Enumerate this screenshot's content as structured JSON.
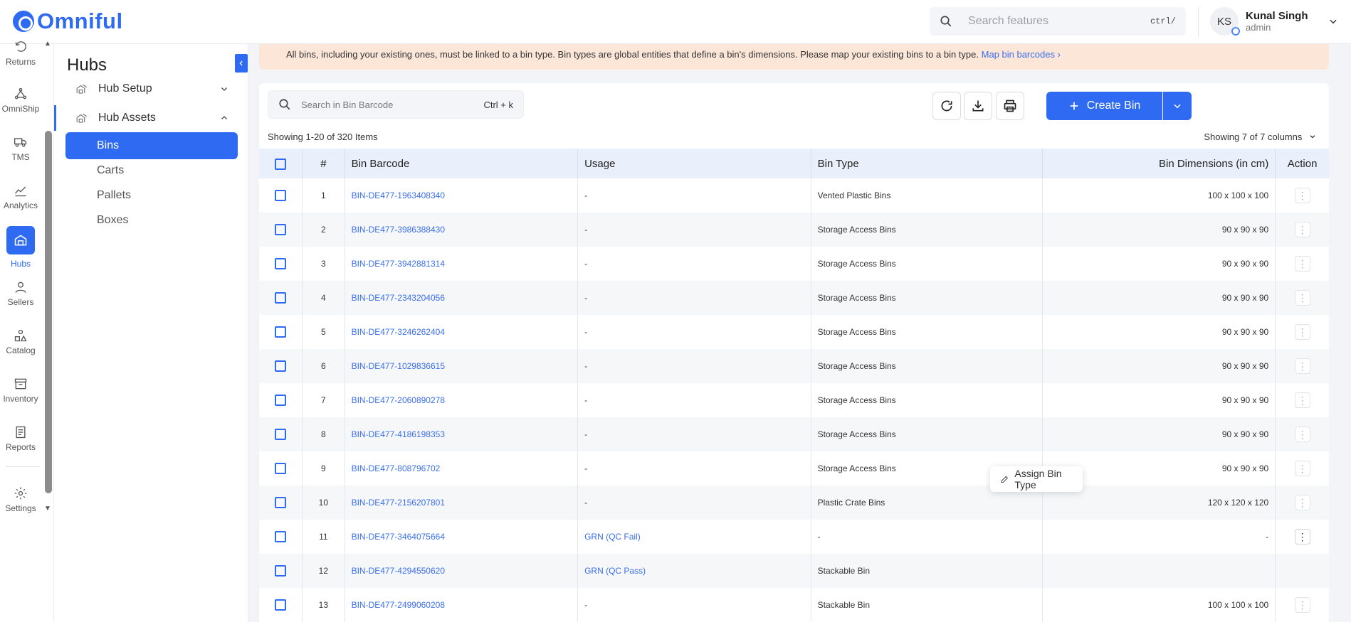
{
  "app": {
    "name": "Omniful"
  },
  "topbar": {
    "search_placeholder": "Search features",
    "search_shortcut": "ctrl/",
    "user_initials": "KS",
    "user_name": "Kunal Singh",
    "user_role": "admin"
  },
  "rail": {
    "items": [
      {
        "label": "Returns",
        "icon": "returns-icon"
      },
      {
        "label": "OmniShip",
        "icon": "omniship-icon"
      },
      {
        "label": "TMS",
        "icon": "truck-icon"
      },
      {
        "label": "Analytics",
        "icon": "analytics-icon"
      },
      {
        "label": "Hubs",
        "icon": "hubs-icon",
        "active": true
      },
      {
        "label": "Sellers",
        "icon": "user-icon"
      },
      {
        "label": "Catalog",
        "icon": "catalog-icon"
      },
      {
        "label": "Inventory",
        "icon": "inventory-icon"
      },
      {
        "label": "Reports",
        "icon": "reports-icon"
      },
      {
        "label": "Settings",
        "icon": "gear-icon"
      }
    ]
  },
  "subnav": {
    "title": "Hubs",
    "groups": [
      {
        "label": "Hub Setup",
        "expanded": false
      },
      {
        "label": "Hub Assets",
        "expanded": true
      }
    ],
    "items": [
      {
        "label": "Bins",
        "active": true
      },
      {
        "label": "Carts"
      },
      {
        "label": "Pallets"
      },
      {
        "label": "Boxes"
      }
    ]
  },
  "banner": {
    "text": "All bins, including your existing ones, must be linked to a bin type. Bin types are global entities that define a bin's dimensions. Please map your existing bins to a bin type.",
    "link": "Map bin barcodes"
  },
  "toolbar": {
    "search_placeholder": "Search in Bin Barcode",
    "search_shortcut": "Ctrl + k",
    "create_label": "Create Bin",
    "showing_text": "Showing 1-20 of 320 Items",
    "columns_text": "Showing 7 of 7 columns"
  },
  "table": {
    "headers": {
      "num": "#",
      "barcode": "Bin Barcode",
      "usage": "Usage",
      "type": "Bin Type",
      "dimensions": "Bin Dimensions (in cm)",
      "action": "Action"
    },
    "rows": [
      {
        "num": "1",
        "barcode": "BIN-DE477-1963408340",
        "usage": "-",
        "type": "Vented Plastic Bins",
        "dimensions": "100 x 100 x 100"
      },
      {
        "num": "2",
        "barcode": "BIN-DE477-3986388430",
        "usage": "-",
        "type": "Storage Access Bins",
        "dimensions": "90 x 90 x 90"
      },
      {
        "num": "3",
        "barcode": "BIN-DE477-3942881314",
        "usage": "-",
        "type": "Storage Access Bins",
        "dimensions": "90 x 90 x 90"
      },
      {
        "num": "4",
        "barcode": "BIN-DE477-2343204056",
        "usage": "-",
        "type": "Storage Access Bins",
        "dimensions": "90 x 90 x 90"
      },
      {
        "num": "5",
        "barcode": "BIN-DE477-3246262404",
        "usage": "-",
        "type": "Storage Access Bins",
        "dimensions": "90 x 90 x 90"
      },
      {
        "num": "6",
        "barcode": "BIN-DE477-1029836615",
        "usage": "-",
        "type": "Storage Access Bins",
        "dimensions": "90 x 90 x 90"
      },
      {
        "num": "7",
        "barcode": "BIN-DE477-2060890278",
        "usage": "-",
        "type": "Storage Access Bins",
        "dimensions": "90 x 90 x 90"
      },
      {
        "num": "8",
        "barcode": "BIN-DE477-4186198353",
        "usage": "-",
        "type": "Storage Access Bins",
        "dimensions": "90 x 90 x 90"
      },
      {
        "num": "9",
        "barcode": "BIN-DE477-808796702",
        "usage": "-",
        "type": "Storage Access Bins",
        "dimensions": "90 x 90 x 90"
      },
      {
        "num": "10",
        "barcode": "BIN-DE477-2156207801",
        "usage": "-",
        "type": "Plastic Crate Bins",
        "dimensions": "120 x 120 x 120"
      },
      {
        "num": "11",
        "barcode": "BIN-DE477-3464075664",
        "usage": "GRN (QC Fail)",
        "type": "-",
        "dimensions": "-"
      },
      {
        "num": "12",
        "barcode": "BIN-DE477-4294550620",
        "usage": "GRN (QC Pass)",
        "type": "Stackable Bin",
        "dimensions": ""
      },
      {
        "num": "13",
        "barcode": "BIN-DE477-2499060208",
        "usage": "-",
        "type": "Stackable Bin",
        "dimensions": "100 x 100 x 100"
      }
    ]
  },
  "popover": {
    "label": "Assign Bin Type"
  },
  "colors": {
    "accent": "#2f6bf2",
    "banner_bg": "#fbe6d8",
    "link": "#3a6ff0"
  }
}
